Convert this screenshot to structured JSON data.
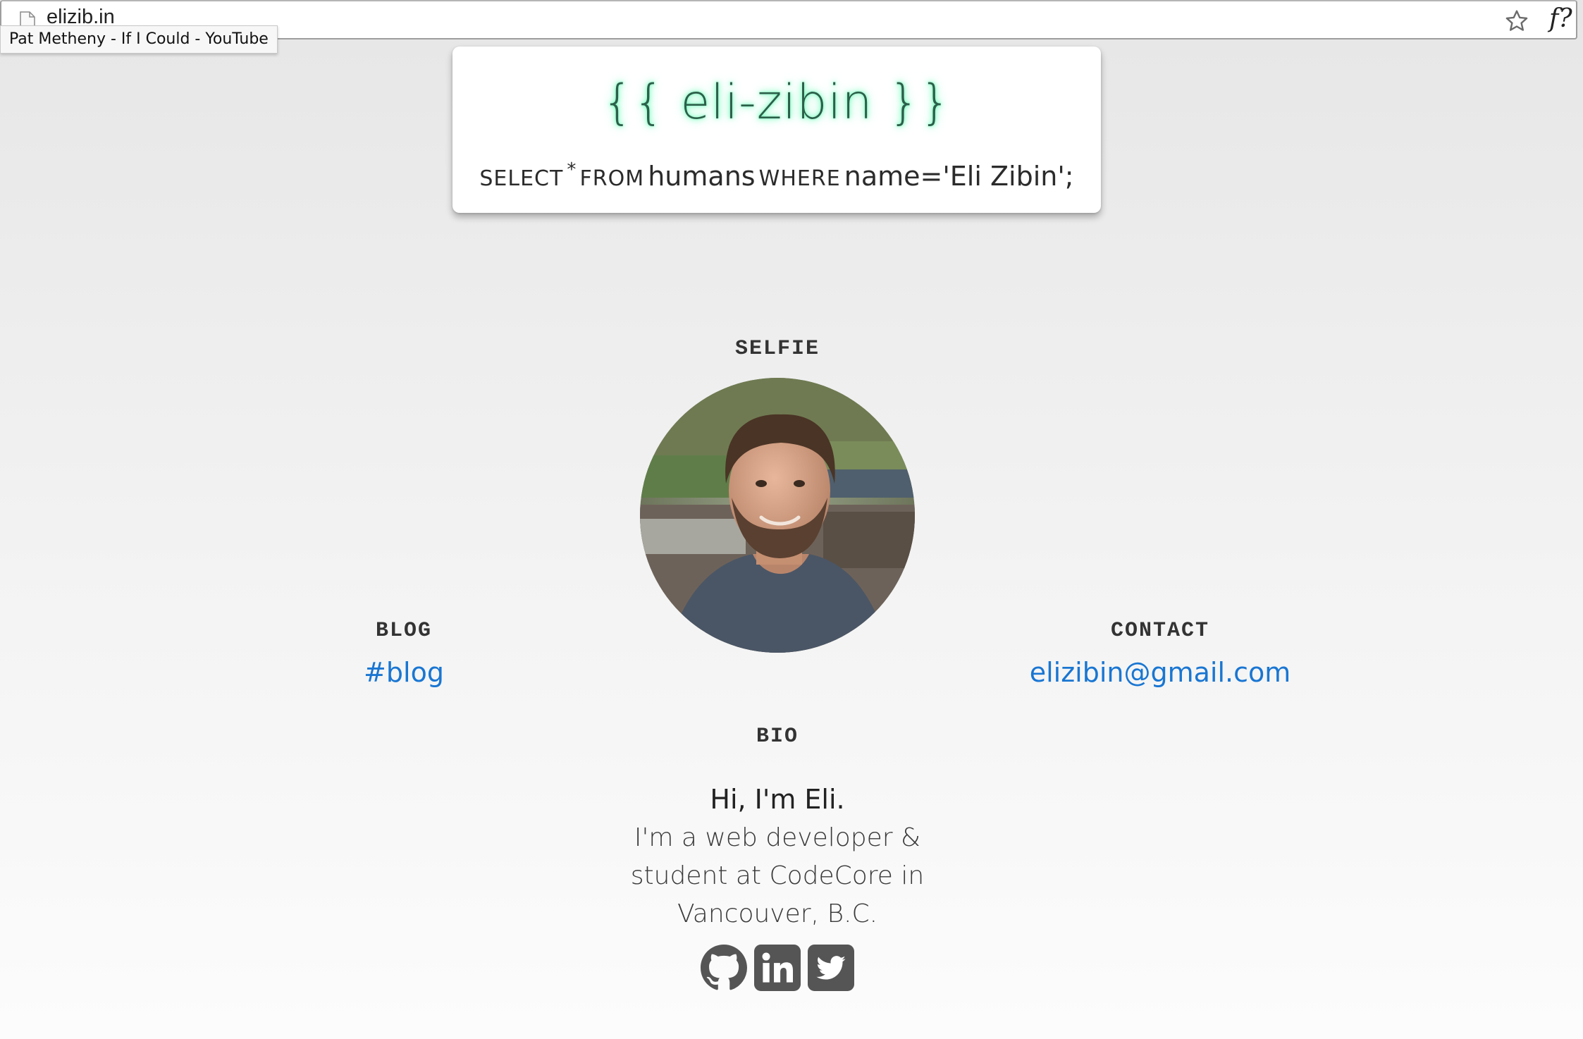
{
  "browser": {
    "url": "elizib.in",
    "tooltip": "Pat Metheny - If I Could - YouTube",
    "extension_label": "f?"
  },
  "header": {
    "title": "{{ eli-zibin }}",
    "sql": {
      "select": "SELECT",
      "star": "*",
      "from": "FROM",
      "table": "humans",
      "where": "WHERE",
      "condition": "name='Eli Zibin';"
    }
  },
  "sections": {
    "selfie_heading": "SELFIE",
    "blog_heading": "BLOG",
    "contact_heading": "CONTACT",
    "bio_heading": "BIO"
  },
  "links": {
    "blog": "#blog",
    "email": "elizibin@gmail.com"
  },
  "bio": {
    "greeting": "Hi, I'm Eli.",
    "line1": "I'm a web developer &",
    "line2": "student at CodeCore in",
    "line3": "Vancouver, B.C."
  },
  "social_icons": [
    "github-icon",
    "linkedin-icon",
    "twitter-icon"
  ],
  "colors": {
    "link": "#1976d2",
    "title_glow": "#5fffb0",
    "icon": "#555555"
  }
}
